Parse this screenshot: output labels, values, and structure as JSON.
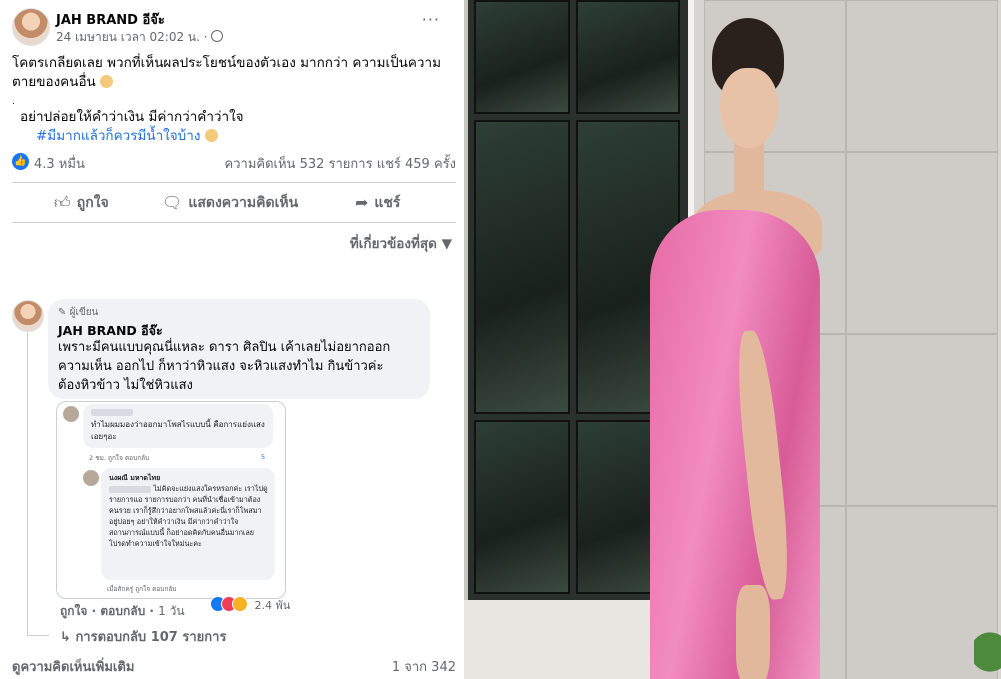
{
  "post": {
    "page_name": "JAH BRAND อีจ๊ะ",
    "time": "24 เมษายน เวลา 02:02 น. ·",
    "more": "···",
    "lines": [
      "โคตรเกลียดเลย พวกที่เห็นผลประโยชน์ของตัวเอง มากกว่า ความเป็นความ",
      "ตายของคนอื่น",
      ".",
      "อย่าปล่อยให้คำว่าเงิน มีค่ากว่าคำว่าใจ",
      "#มีมากแล้วก็ควรมีน้ำใจบ้าง"
    ],
    "reaction_count": "4.3 หมื่น",
    "comments_shares": "ความคิดเห็น 532 รายการ  แชร์ 459 ครั้ง"
  },
  "actions": {
    "like": "ถูกใจ",
    "comment": "แสดงความคิดเห็น",
    "share": "แชร์"
  },
  "sort_label": "ที่เกี่ยวข้องที่สุด",
  "comment": {
    "author_tag": "ผู้เขียน",
    "name": "JAH BRAND อีจ๊ะ",
    "lines": [
      "เพราะมีคนแบบคุณนี่แหละ ดารา ศิลปิน เค้าเลยไม่อยากออก",
      "ความเห็น ออกไป ก็หาว่าหิวแสง จะหิวแสงทำไม กินข้าวค่ะ",
      "ต้องหิวข้าว ไม่ใช่หิวแสง"
    ],
    "like": "ถูกใจ",
    "reply": "ตอบกลับ",
    "age": "1 วัน",
    "reactions": "2.4 พัน",
    "replies": "การตอบกลับ 107 รายการ"
  },
  "screenshot": {
    "c1_text": "ทำไมผมมองว่าออกมาโพสไรแบบนี้ คือการแย่งแสงเอยๆอะ",
    "c1_meta": "2 ชม.   ถูกใจ   ตอบกลับ",
    "c1_count": "5",
    "c2_name": "นงผณี มหาดไทย",
    "c2_text": "ไม่คิดจะแย่งแสงใครหรอกค่ะ เราไปดูรายการแอ รายการบอกว่า คนที่นำเชื่อเข้ามาต้องคนรวย เราก็รู้สึกว่าอยากโพสแล้วค่ะนี่เราก็โพสมาอยู่บ่อยๆ อย่าให้คำว่าเงิน มีค่ากว่าคำว่าใจ สถานการณ์แบบนี้ ก็อย่าอดคิดกับคนอื่นมากเลย โปรดทำความเข้าใจใหม่นะคะ",
    "c2_meta": "เมื่อสักครู่   ถูกใจ   ตอบกลับ"
  },
  "footer": {
    "more_comments": "ดูความคิดเห็นเพิ่มเติม",
    "pager": "1 จาก 342"
  },
  "colors": {
    "like_blue": "#1877f2",
    "hashtag": "#216fdb",
    "dress_pink": "#ee7fb5"
  }
}
